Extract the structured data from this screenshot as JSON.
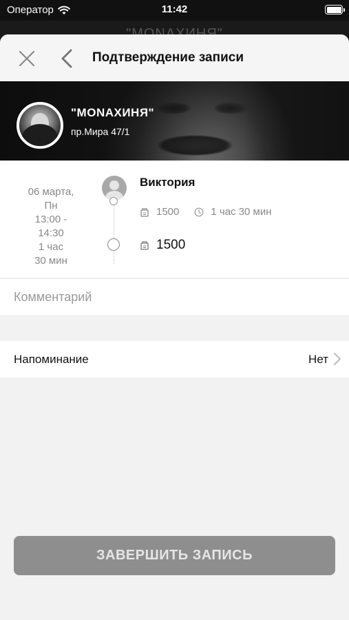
{
  "status_bar": {
    "carrier": "Оператор",
    "time": "11:42"
  },
  "background": {
    "title": "\"MONAХИНЯ\""
  },
  "header": {
    "title": "Подтверждение записи"
  },
  "salon": {
    "name": "\"MONAХИНЯ\"",
    "address": "пр.Мира 47/1"
  },
  "booking": {
    "date_line1": "06 марта,",
    "date_line2": "Пн",
    "time_line1": "13:00 -",
    "time_line2": "14:30",
    "duration_line1": "1 час",
    "duration_line2": "30 мин",
    "master": "Виктория",
    "service_price": "1500",
    "service_duration": "1 час 30 мин",
    "total_price": "1500"
  },
  "comment": {
    "placeholder": "Комментарий",
    "value": ""
  },
  "reminder": {
    "label": "Напоминание",
    "value": "Нет"
  },
  "submit": {
    "label": "ЗАВЕРШИТЬ ЗАПИСЬ"
  },
  "colors": {
    "submit_bg": "#8e8e8e",
    "sheet_bg": "#f2f2f2"
  }
}
